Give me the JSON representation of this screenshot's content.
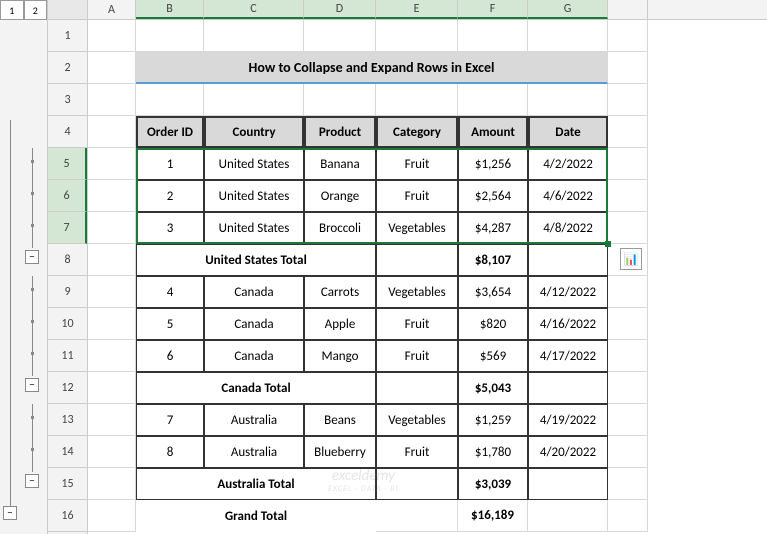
{
  "outline": {
    "levels": [
      "1",
      "2"
    ],
    "minus": "−"
  },
  "col_letters": [
    "A",
    "B",
    "C",
    "D",
    "E",
    "F",
    "G",
    ""
  ],
  "row_numbers": [
    "1",
    "2",
    "3",
    "4",
    "5",
    "6",
    "7",
    "8",
    "9",
    "10",
    "11",
    "12",
    "13",
    "14",
    "15",
    "16"
  ],
  "title": "How to Collapse and Expand Rows in Excel",
  "headers": [
    "Order ID",
    "Country",
    "Product",
    "Category",
    "Amount",
    "Date"
  ],
  "rows": [
    {
      "id": "1",
      "country": "United States",
      "product": "Banana",
      "category": "Fruit",
      "amount": "$1,256",
      "date": "4/2/2022"
    },
    {
      "id": "2",
      "country": "United States",
      "product": "Orange",
      "category": "Fruit",
      "amount": "$2,564",
      "date": "4/6/2022"
    },
    {
      "id": "3",
      "country": "United States",
      "product": "Broccoli",
      "category": "Vegetables",
      "amount": "$4,287",
      "date": "4/8/2022"
    },
    {
      "id": "4",
      "country": "Canada",
      "product": "Carrots",
      "category": "Vegetables",
      "amount": "$3,654",
      "date": "4/12/2022"
    },
    {
      "id": "5",
      "country": "Canada",
      "product": "Apple",
      "category": "Fruit",
      "amount": "$820",
      "date": "4/16/2022"
    },
    {
      "id": "6",
      "country": "Canada",
      "product": "Mango",
      "category": "Fruit",
      "amount": "$569",
      "date": "4/17/2022"
    },
    {
      "id": "7",
      "country": "Australia",
      "product": "Beans",
      "category": "Vegetables",
      "amount": "$1,259",
      "date": "4/19/2022"
    },
    {
      "id": "8",
      "country": "Australia",
      "product": "Blueberry",
      "category": "Fruit",
      "amount": "$1,780",
      "date": "4/20/2022"
    }
  ],
  "subtotals": [
    {
      "label": "United States Total",
      "amount": "$8,107"
    },
    {
      "label": "Canada  Total",
      "amount": "$5,043"
    },
    {
      "label": "Australia  Total",
      "amount": "$3,039"
    }
  ],
  "grand": {
    "label": "Grand Total",
    "amount": "$16,189"
  },
  "qa_icon": "📊",
  "watermark": {
    "line1": "exceldemy",
    "line2": "EXCEL · DATA · BI"
  }
}
